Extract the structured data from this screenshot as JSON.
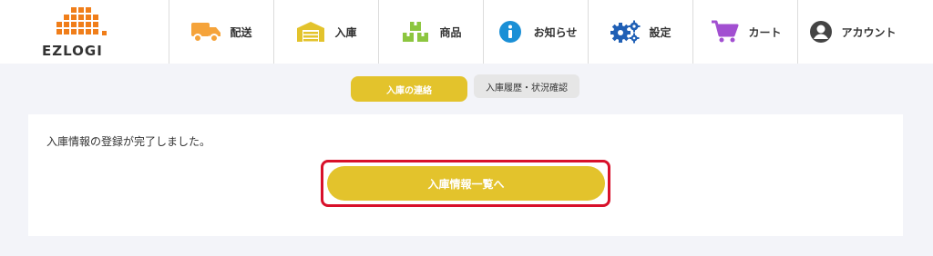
{
  "brand": {
    "name": "EZLOGI",
    "accent": "#e3c32c",
    "logo_color": "#f07e1a"
  },
  "nav": [
    {
      "label": "配送",
      "icon": "truck-icon",
      "color": "#f5a33a"
    },
    {
      "label": "入庫",
      "icon": "warehouse-icon",
      "color": "#e3c32c"
    },
    {
      "label": "商品",
      "icon": "boxes-icon",
      "color": "#8cc63f"
    },
    {
      "label": "お知らせ",
      "icon": "info-icon",
      "color": "#1a8fd6"
    },
    {
      "label": "設定",
      "icon": "gears-icon",
      "color": "#1f5fb5"
    },
    {
      "label": "カート",
      "icon": "cart-icon",
      "color": "#a24fd1"
    },
    {
      "label": "アカウント",
      "icon": "account-icon",
      "color": "#444444"
    }
  ],
  "subtabs": {
    "active": "入庫の連絡",
    "other": "入庫履歴・状況確認"
  },
  "panel": {
    "message": "入庫情報の登録が完了しました。",
    "button_label": "入庫情報一覧へ"
  }
}
